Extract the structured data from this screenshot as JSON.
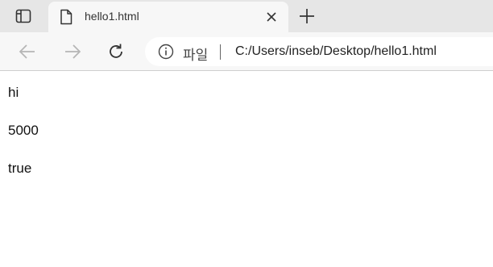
{
  "tab": {
    "title": "hello1.html",
    "favicon_icon": "document-icon"
  },
  "toolbar": {
    "back_icon": "arrow-left-icon",
    "forward_icon": "arrow-right-icon",
    "refresh_icon": "refresh-icon"
  },
  "addressbar": {
    "site_label": "파일",
    "url": "C:/Users/inseb/Desktop/hello1.html"
  },
  "page": {
    "lines": [
      "hi",
      "5000",
      "true"
    ]
  },
  "colors": {
    "tabstrip": "#e6e6e6",
    "toolbar": "#f7f7f7",
    "disabled_icon": "#b5b5b5",
    "icon": "#333333"
  }
}
